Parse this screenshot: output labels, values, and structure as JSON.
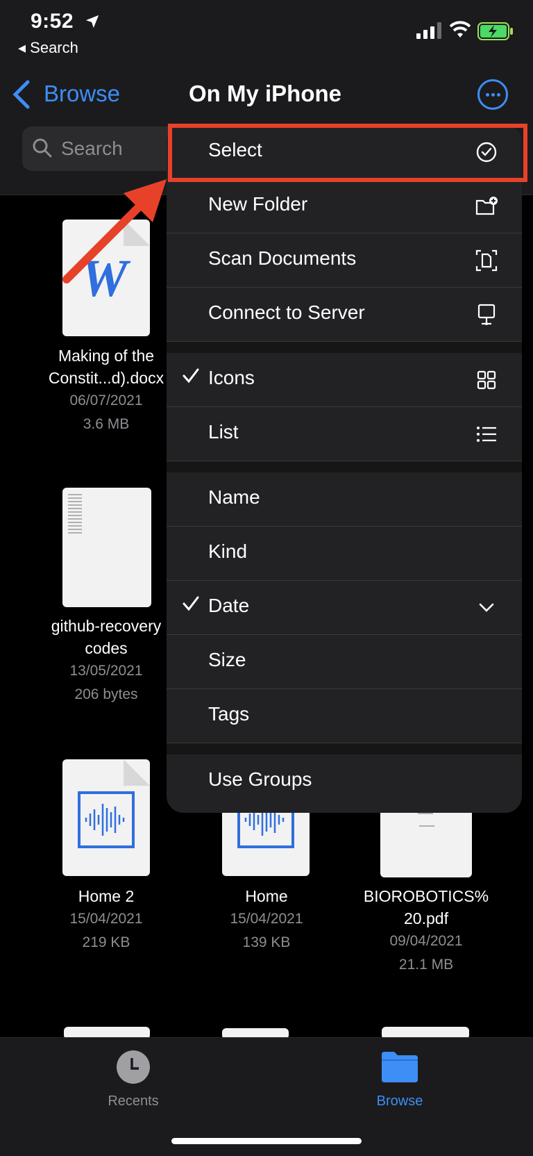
{
  "status_bar": {
    "time": "9:52",
    "back_app": "◂ Search"
  },
  "nav": {
    "back_label": "Browse",
    "title": "On My iPhone",
    "search_placeholder": "Search"
  },
  "files": [
    {
      "name_line1": "Making of the",
      "name_line2": "Constit...d).docx",
      "date": "06/07/2021",
      "size": "3.6 MB",
      "kind": "word-doc-icon",
      "word_letter": "W"
    },
    {
      "name_line1": "github-recovery",
      "name_line2": "codes",
      "date": "13/05/2021",
      "size": "206 bytes",
      "kind": "text-doc-icon"
    },
    {
      "name_line1": "Home 2",
      "name_line2": "",
      "date": "15/04/2021",
      "size": "219 KB",
      "kind": "audio-file-icon"
    },
    {
      "name_line1": "Home",
      "name_line2": "",
      "date": "15/04/2021",
      "size": "139 KB",
      "kind": "audio-file-icon"
    },
    {
      "name_line1": "BIOROBOTICS%",
      "name_line2": "20.pdf",
      "date": "09/04/2021",
      "size": "21.1 MB",
      "kind": "pdf-file-icon"
    }
  ],
  "menu": {
    "items": [
      {
        "label": "Select",
        "icon": "checkmark-circle-icon"
      },
      {
        "label": "New Folder",
        "icon": "folder-add-icon"
      },
      {
        "label": "Scan Documents",
        "icon": "scan-document-icon"
      },
      {
        "label": "Connect to Server",
        "icon": "server-display-icon"
      },
      {
        "label": "Icons",
        "icon": "grid-icon",
        "checked": true
      },
      {
        "label": "List",
        "icon": "list-icon"
      },
      {
        "label": "Name"
      },
      {
        "label": "Kind"
      },
      {
        "label": "Date",
        "icon": "chevron-down-icon",
        "checked": true
      },
      {
        "label": "Size"
      },
      {
        "label": "Tags"
      },
      {
        "label": "Use Groups"
      }
    ]
  },
  "tabbar": {
    "recents": "Recents",
    "browse": "Browse"
  },
  "colors": {
    "accent": "#3d8ef7",
    "highlight": "#e8412a",
    "menu_bg": "#222224"
  }
}
